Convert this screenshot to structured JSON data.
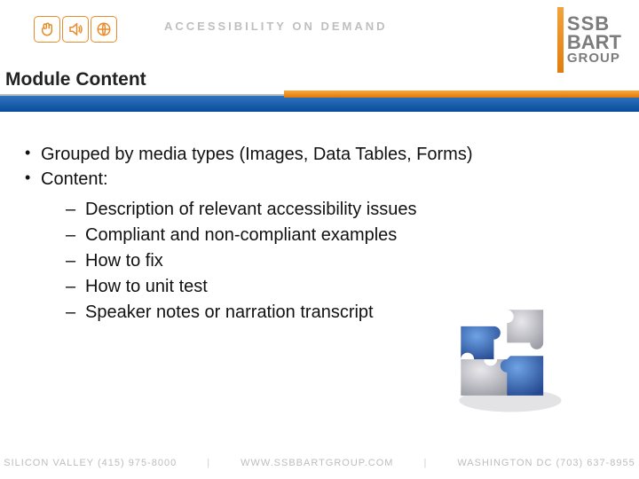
{
  "header": {
    "tagline": "ACCESSIBILITY ON DEMAND",
    "logo": {
      "line1": "SSB",
      "line2": "BART",
      "line3": "GROUP"
    },
    "icons": [
      "hand-icon",
      "sound-icon",
      "globe-icon"
    ]
  },
  "title": "Module Content",
  "bullets": [
    "Grouped by media types (Images, Data Tables, Forms)",
    "Content:"
  ],
  "sub_bullets": [
    "Description of relevant accessibility issues",
    "Compliant and non-compliant examples",
    "How to fix",
    "How to unit test",
    "Speaker notes or narration transcript"
  ],
  "footer": {
    "left": "SILICON VALLEY (415) 975-8000",
    "center": "WWW.SSBBARTGROUP.COM",
    "right": "WASHINGTON DC (703) 637-8955"
  },
  "colors": {
    "orange": "#e98b2a",
    "blue": "#1a5aa5",
    "grey": "#bfbfbf"
  }
}
